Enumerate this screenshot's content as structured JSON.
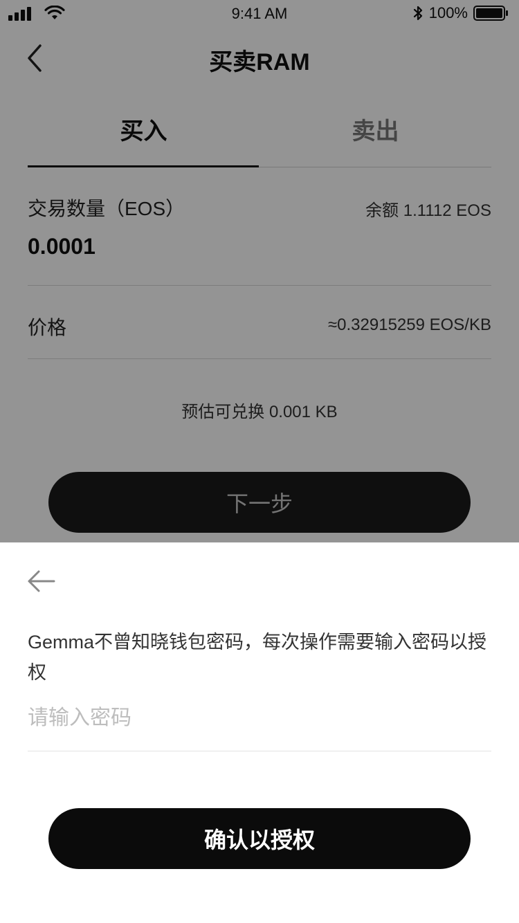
{
  "status_bar": {
    "time": "9:41 AM",
    "battery_text": "100%",
    "icons": [
      "signal-icon",
      "wifi-icon",
      "bluetooth-icon",
      "battery-icon"
    ]
  },
  "nav": {
    "title": "买卖RAM",
    "back_icon": "chevron-left-icon"
  },
  "tabs": [
    {
      "label": "买入",
      "active": true
    },
    {
      "label": "卖出",
      "active": false
    }
  ],
  "form": {
    "amount_label": "交易数量（EOS）",
    "balance_text": "余额 1.1112 EOS",
    "amount_value": "0.0001",
    "price_label": "价格",
    "price_value": "≈0.32915259 EOS/KB",
    "estimate_text": "预估可兑换 0.001 KB",
    "next_label": "下一步"
  },
  "sheet": {
    "back_icon": "arrow-left-icon",
    "description": "Gemma不曾知晓钱包密码，每次操作需要输入密码以授权",
    "password_placeholder": "请输入密码",
    "password_value": "",
    "confirm_label": "确认以授权"
  },
  "colors": {
    "overlay": "#000000",
    "primary_button": "#0b0b0b",
    "sheet_background": "#ffffff"
  }
}
